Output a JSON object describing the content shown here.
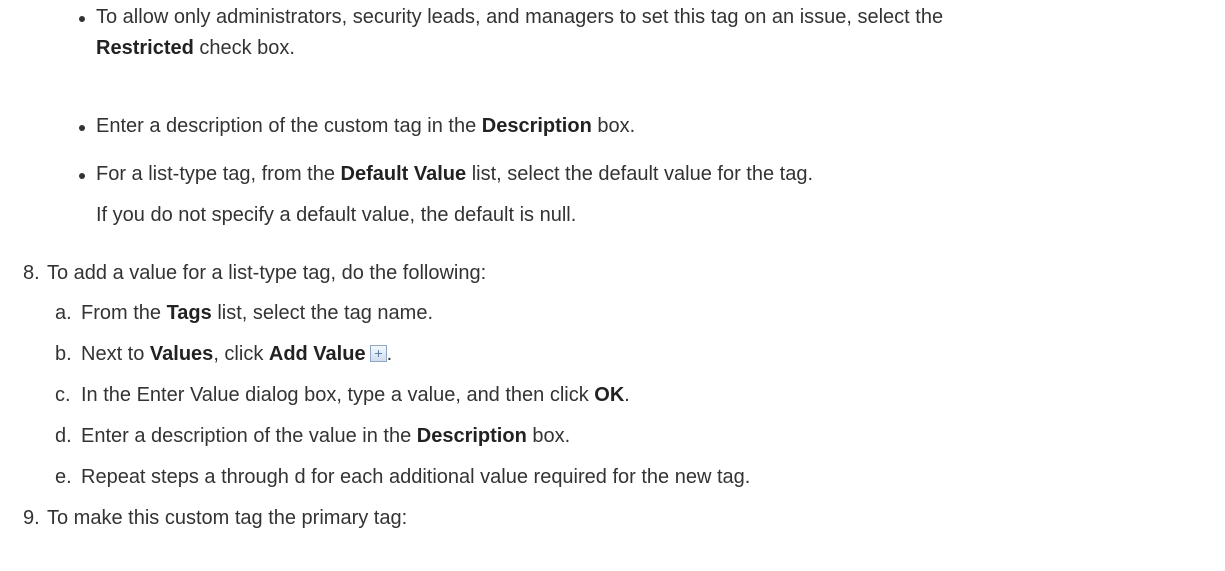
{
  "bullets": [
    {
      "pre": "To allow only administrators, security leads, and managers to set this tag on an issue, select the ",
      "bold": "Restricted",
      "post": " check box."
    },
    {
      "pre": "Enter a description of the custom tag in the ",
      "bold": "Description",
      "post": " box."
    },
    {
      "pre": "For a list-type tag, from the ",
      "bold": "Default Value",
      "post": " list, select the default value for the tag.",
      "continuation": "If you do not specify a default value, the default is null."
    }
  ],
  "step8": {
    "number": "8.",
    "text": "To add a value for a list-type tag, do the following:",
    "substeps": [
      {
        "letter": "a.",
        "pre": "From the ",
        "bold": "Tags",
        "post": " list, select the tag name."
      },
      {
        "letter": "b.",
        "pre": "Next to ",
        "bold": "Values",
        "mid": ", click ",
        "bold2": "Add Value",
        "icon": "add-value-icon",
        "post": "."
      },
      {
        "letter": "c.",
        "pre": "In the Enter Value dialog box, type a value, and then click ",
        "bold": "OK",
        "post": "."
      },
      {
        "letter": "d.",
        "pre": "Enter a description of the value in the ",
        "bold": "Description",
        "post": " box."
      },
      {
        "letter": "e.",
        "pre": "Repeat steps a through d for each additional value required for the new tag."
      }
    ]
  },
  "step9": {
    "number": "9.",
    "text": "To make this custom tag the primary tag:"
  }
}
